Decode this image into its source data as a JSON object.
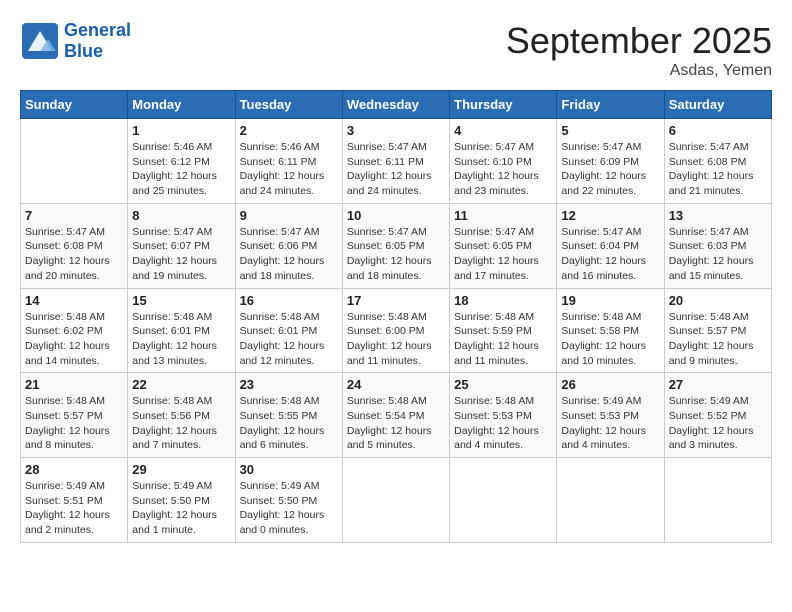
{
  "header": {
    "logo_text_general": "General",
    "logo_text_blue": "Blue",
    "month_title": "September 2025",
    "location": "Asdas, Yemen"
  },
  "days_of_week": [
    "Sunday",
    "Monday",
    "Tuesday",
    "Wednesday",
    "Thursday",
    "Friday",
    "Saturday"
  ],
  "weeks": [
    [
      {
        "day": "",
        "info": ""
      },
      {
        "day": "1",
        "info": "Sunrise: 5:46 AM\nSunset: 6:12 PM\nDaylight: 12 hours\nand 25 minutes."
      },
      {
        "day": "2",
        "info": "Sunrise: 5:46 AM\nSunset: 6:11 PM\nDaylight: 12 hours\nand 24 minutes."
      },
      {
        "day": "3",
        "info": "Sunrise: 5:47 AM\nSunset: 6:11 PM\nDaylight: 12 hours\nand 24 minutes."
      },
      {
        "day": "4",
        "info": "Sunrise: 5:47 AM\nSunset: 6:10 PM\nDaylight: 12 hours\nand 23 minutes."
      },
      {
        "day": "5",
        "info": "Sunrise: 5:47 AM\nSunset: 6:09 PM\nDaylight: 12 hours\nand 22 minutes."
      },
      {
        "day": "6",
        "info": "Sunrise: 5:47 AM\nSunset: 6:08 PM\nDaylight: 12 hours\nand 21 minutes."
      }
    ],
    [
      {
        "day": "7",
        "info": "Sunrise: 5:47 AM\nSunset: 6:08 PM\nDaylight: 12 hours\nand 20 minutes."
      },
      {
        "day": "8",
        "info": "Sunrise: 5:47 AM\nSunset: 6:07 PM\nDaylight: 12 hours\nand 19 minutes."
      },
      {
        "day": "9",
        "info": "Sunrise: 5:47 AM\nSunset: 6:06 PM\nDaylight: 12 hours\nand 18 minutes."
      },
      {
        "day": "10",
        "info": "Sunrise: 5:47 AM\nSunset: 6:05 PM\nDaylight: 12 hours\nand 18 minutes."
      },
      {
        "day": "11",
        "info": "Sunrise: 5:47 AM\nSunset: 6:05 PM\nDaylight: 12 hours\nand 17 minutes."
      },
      {
        "day": "12",
        "info": "Sunrise: 5:47 AM\nSunset: 6:04 PM\nDaylight: 12 hours\nand 16 minutes."
      },
      {
        "day": "13",
        "info": "Sunrise: 5:47 AM\nSunset: 6:03 PM\nDaylight: 12 hours\nand 15 minutes."
      }
    ],
    [
      {
        "day": "14",
        "info": "Sunrise: 5:48 AM\nSunset: 6:02 PM\nDaylight: 12 hours\nand 14 minutes."
      },
      {
        "day": "15",
        "info": "Sunrise: 5:48 AM\nSunset: 6:01 PM\nDaylight: 12 hours\nand 13 minutes."
      },
      {
        "day": "16",
        "info": "Sunrise: 5:48 AM\nSunset: 6:01 PM\nDaylight: 12 hours\nand 12 minutes."
      },
      {
        "day": "17",
        "info": "Sunrise: 5:48 AM\nSunset: 6:00 PM\nDaylight: 12 hours\nand 11 minutes."
      },
      {
        "day": "18",
        "info": "Sunrise: 5:48 AM\nSunset: 5:59 PM\nDaylight: 12 hours\nand 11 minutes."
      },
      {
        "day": "19",
        "info": "Sunrise: 5:48 AM\nSunset: 5:58 PM\nDaylight: 12 hours\nand 10 minutes."
      },
      {
        "day": "20",
        "info": "Sunrise: 5:48 AM\nSunset: 5:57 PM\nDaylight: 12 hours\nand 9 minutes."
      }
    ],
    [
      {
        "day": "21",
        "info": "Sunrise: 5:48 AM\nSunset: 5:57 PM\nDaylight: 12 hours\nand 8 minutes."
      },
      {
        "day": "22",
        "info": "Sunrise: 5:48 AM\nSunset: 5:56 PM\nDaylight: 12 hours\nand 7 minutes."
      },
      {
        "day": "23",
        "info": "Sunrise: 5:48 AM\nSunset: 5:55 PM\nDaylight: 12 hours\nand 6 minutes."
      },
      {
        "day": "24",
        "info": "Sunrise: 5:48 AM\nSunset: 5:54 PM\nDaylight: 12 hours\nand 5 minutes."
      },
      {
        "day": "25",
        "info": "Sunrise: 5:48 AM\nSunset: 5:53 PM\nDaylight: 12 hours\nand 4 minutes."
      },
      {
        "day": "26",
        "info": "Sunrise: 5:49 AM\nSunset: 5:53 PM\nDaylight: 12 hours\nand 4 minutes."
      },
      {
        "day": "27",
        "info": "Sunrise: 5:49 AM\nSunset: 5:52 PM\nDaylight: 12 hours\nand 3 minutes."
      }
    ],
    [
      {
        "day": "28",
        "info": "Sunrise: 5:49 AM\nSunset: 5:51 PM\nDaylight: 12 hours\nand 2 minutes."
      },
      {
        "day": "29",
        "info": "Sunrise: 5:49 AM\nSunset: 5:50 PM\nDaylight: 12 hours\nand 1 minute."
      },
      {
        "day": "30",
        "info": "Sunrise: 5:49 AM\nSunset: 5:50 PM\nDaylight: 12 hours\nand 0 minutes."
      },
      {
        "day": "",
        "info": ""
      },
      {
        "day": "",
        "info": ""
      },
      {
        "day": "",
        "info": ""
      },
      {
        "day": "",
        "info": ""
      }
    ]
  ]
}
